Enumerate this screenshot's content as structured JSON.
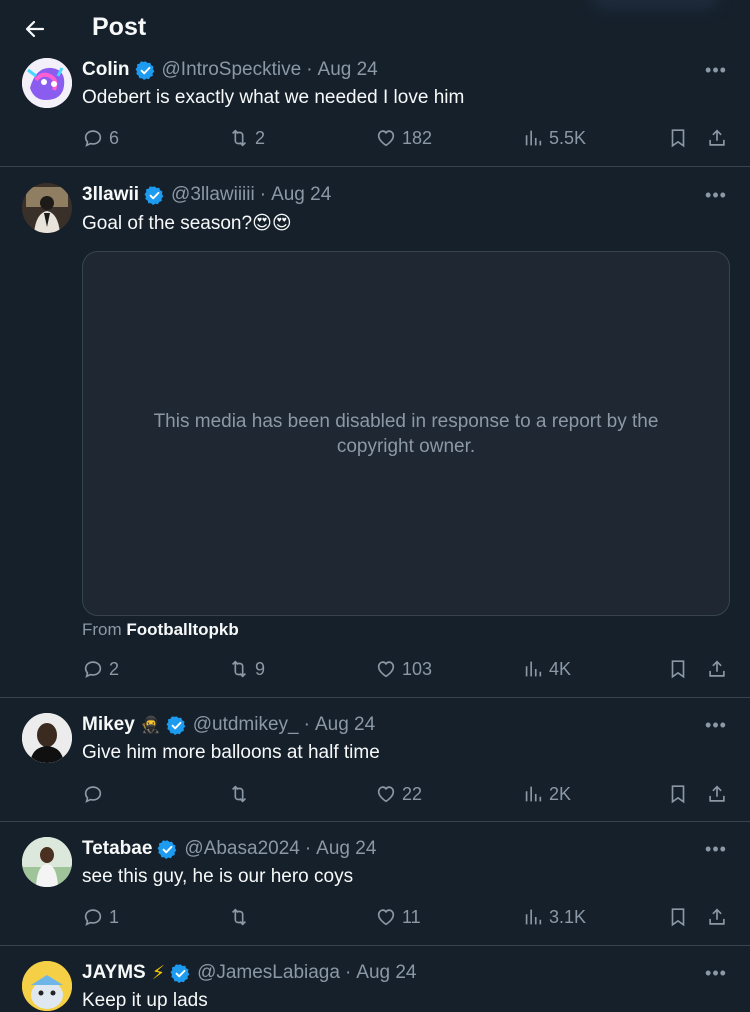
{
  "header": {
    "title": "Post"
  },
  "posts": [
    {
      "name": "Colin",
      "emoji": "",
      "handle": "@IntroSpecktive",
      "date": "Aug 24",
      "text": "Odebert is exactly what we needed I love him",
      "replies": "6",
      "reposts": "2",
      "likes": "182",
      "views": "5.5K"
    },
    {
      "name": "3llawii",
      "emoji": "",
      "handle": "@3llawiiiii",
      "date": "Aug 24",
      "text": "Goal of the season?😍😍",
      "media_notice": "This media has been disabled in response to a report by the copyright owner.",
      "from_label": "From",
      "from_source": "Footballtopkb",
      "replies": "2",
      "reposts": "9",
      "likes": "103",
      "views": "4K"
    },
    {
      "name": "Mikey",
      "emoji": "🥷",
      "handle": "@utdmikey_",
      "date": "Aug 24",
      "text": "Give him more balloons at half time",
      "replies": "",
      "reposts": "",
      "likes": "22",
      "views": "2K"
    },
    {
      "name": "Tetabae",
      "emoji": "",
      "handle": "@Abasa2024",
      "date": "Aug 24",
      "text": "see this guy, he is our hero coys",
      "replies": "1",
      "reposts": "",
      "likes": "11",
      "views": "3.1K"
    },
    {
      "name": "JAYMS",
      "emoji": "⚡",
      "handle": "@JamesLabiaga",
      "date": "Aug 24",
      "text": "Keep it up lads"
    }
  ],
  "colors": {
    "background": "#15202b",
    "verified": "#1d9bf0",
    "muted": "#8b98a5",
    "border": "#38444d"
  },
  "icons": [
    "back-arrow-icon",
    "verified-badge-icon",
    "more-icon",
    "reply-icon",
    "repost-icon",
    "like-icon",
    "views-icon",
    "bookmark-icon",
    "share-icon"
  ]
}
